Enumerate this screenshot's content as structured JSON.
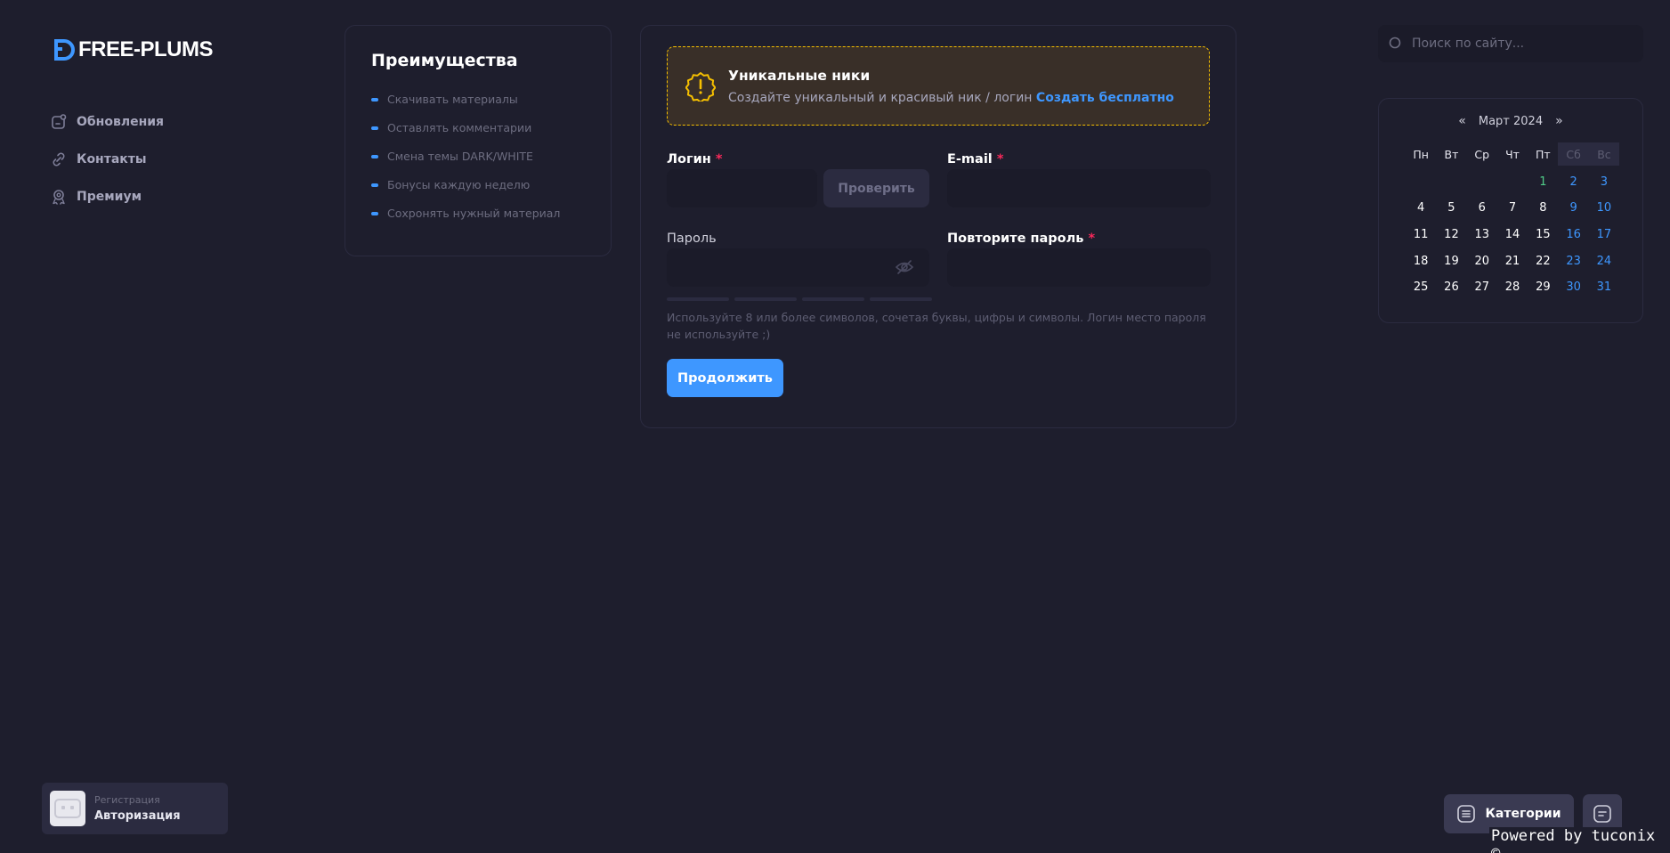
{
  "brand": {
    "name": "FREE-PLUMS",
    "accent": "#3e97ff"
  },
  "nav": {
    "items": [
      {
        "label": "Обновления",
        "icon": "updates-icon"
      },
      {
        "label": "Контакты",
        "icon": "link-icon"
      },
      {
        "label": "Премиум",
        "icon": "premium-icon"
      }
    ]
  },
  "advantages": {
    "title": "Преимущества",
    "items": [
      "Скачивать материалы",
      "Оставлять комментарии",
      "Смена темы DARK/WHITE",
      "Бонусы каждую неделю",
      "Сохронять нужный материал"
    ]
  },
  "notice": {
    "title": "Уникальные ники",
    "text": "Создайте уникальный и красивый ник / логин",
    "link": "Создать бесплатно",
    "border_color": "#f6c000"
  },
  "form": {
    "login_label": "Логин",
    "email_label": "E-mail",
    "password_label": "Пароль",
    "repeat_label": "Повторите пароль",
    "required_mark": "*",
    "check_button": "Проверить",
    "hint": "Используйте 8 или более символов, сочетая буквы, цифры и символы. Логин место пароля не используйте ;)",
    "submit": "Продолжить",
    "login_value": "",
    "email_value": "",
    "password_value": "",
    "repeat_value": ""
  },
  "search": {
    "placeholder": "Поиск по сайту..."
  },
  "calendar": {
    "prev": "«",
    "next": "»",
    "month": "Март 2024",
    "weekdays": [
      "Пн",
      "Вт",
      "Ср",
      "Чт",
      "Пт",
      "Сб",
      "Вс"
    ],
    "leading_blanks": 4,
    "days_in_month": 31,
    "today": 1,
    "colors": {
      "today": "#50cd89",
      "weekend": "#3e97ff",
      "weekday": "#ffffff"
    }
  },
  "auth": {
    "small": "Регистрация",
    "big": "Авторизация"
  },
  "categories_button": "Категории",
  "powered": "Powered by tuconix ©"
}
